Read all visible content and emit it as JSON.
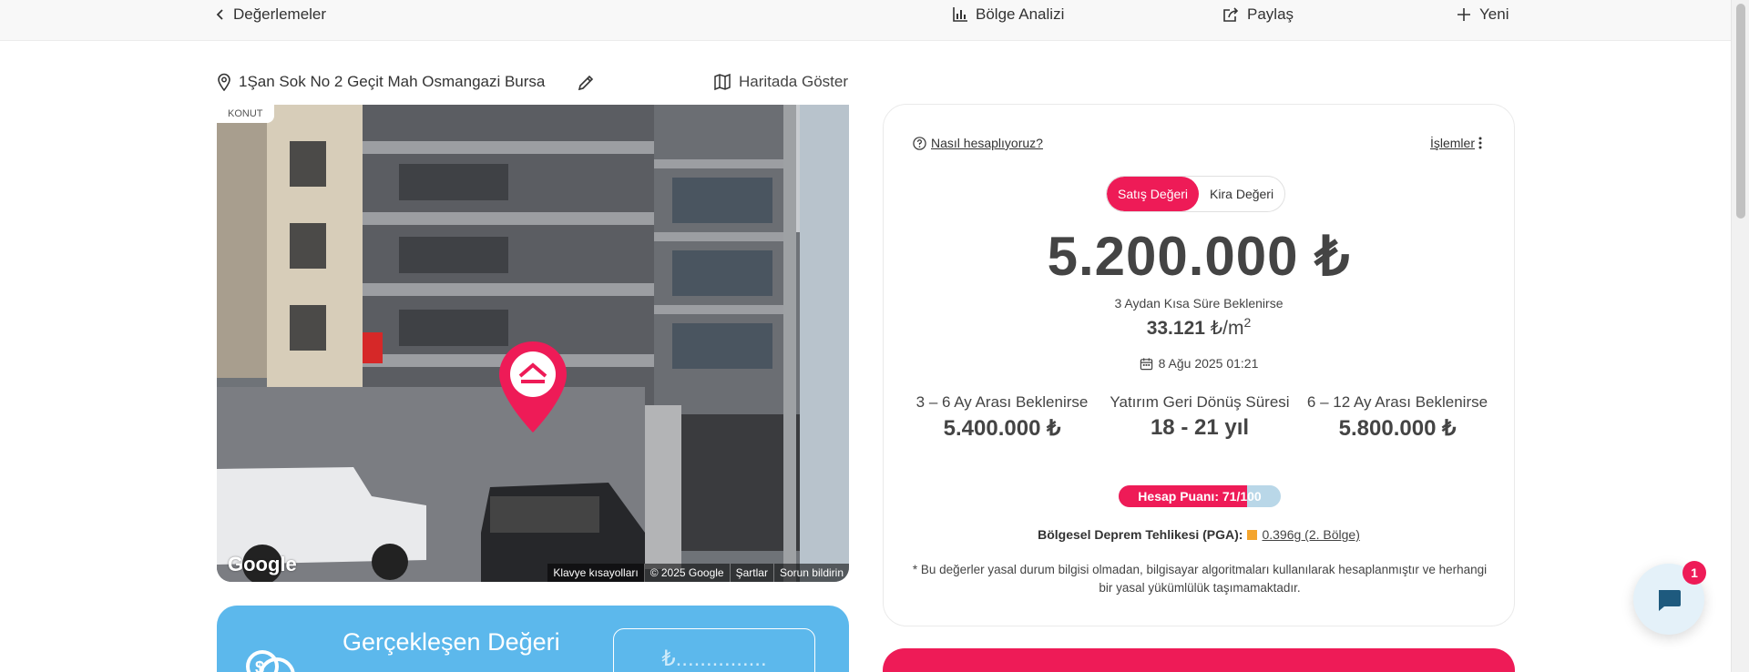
{
  "topbar": {
    "back_label": "Değerlemeler",
    "region_label": "Bölge Analizi",
    "share_label": "Paylaş",
    "new_label": "Yeni"
  },
  "address": {
    "text": "1Şan Sok No 2 Geçit Mah Osmangazi Bursa",
    "map_label": "Haritada Göster"
  },
  "photo": {
    "badge": "KONUT",
    "logo": "Google",
    "attribution": [
      "Klavye kısayolları",
      "© 2025 Google",
      "Şartlar",
      "Sorun bildirin"
    ]
  },
  "real_value": {
    "title": "Gerçekleşen Değeri",
    "input_placeholder": "₺..............."
  },
  "valuation": {
    "how_label": "Nasıl hesaplıyoruz?",
    "ops_label": "İşlemler",
    "toggle": [
      "Satış Değeri",
      "Kira Değeri"
    ],
    "active_toggle": "Satış Değeri",
    "price": "5.200.000 ₺",
    "short_note": "3 Aydan Kısa Süre Beklenirse",
    "per_sqm_value": "33.121",
    "per_sqm_unit": "₺/m",
    "per_sqm_exp": "2",
    "date": "8 Ağu 2025 01:21",
    "stats": [
      {
        "label": "3 – 6 Ay Arası Beklenirse",
        "value": "5.400.000 ₺"
      },
      {
        "label": "Yatırım Geri Dönüş Süresi",
        "value": "18 - 21 yıl"
      },
      {
        "label": "6 – 12 Ay Arası Beklenirse",
        "value": "5.800.000 ₺"
      }
    ],
    "score_text": "Hesap Puanı: 71/100",
    "score_fraction": 0.79,
    "quake_label": "Bölgesel Deprem Tehlikesi (PGA):",
    "quake_value": "0.396g (2. Bölge)",
    "disclaimer": "* Bu değerler yasal durum bilgisi olmadan, bilgisayar algoritmaları kullanılarak hesaplanmıştır ve herhangi bir yasal yükümlülük taşımamaktadır."
  },
  "chat": {
    "badge": "1"
  },
  "colors": {
    "accent": "#ee1b57",
    "blue": "#5cb8ec",
    "warning": "#f4a52e"
  },
  "icons": [
    "chevron-left-icon",
    "bar-chart-icon",
    "share-icon",
    "plus-icon",
    "location-pin-icon",
    "pencil-icon",
    "map-icon",
    "question-circle-icon",
    "more-vertical-icon",
    "calendar-icon",
    "chat-icon",
    "coin-icon"
  ]
}
